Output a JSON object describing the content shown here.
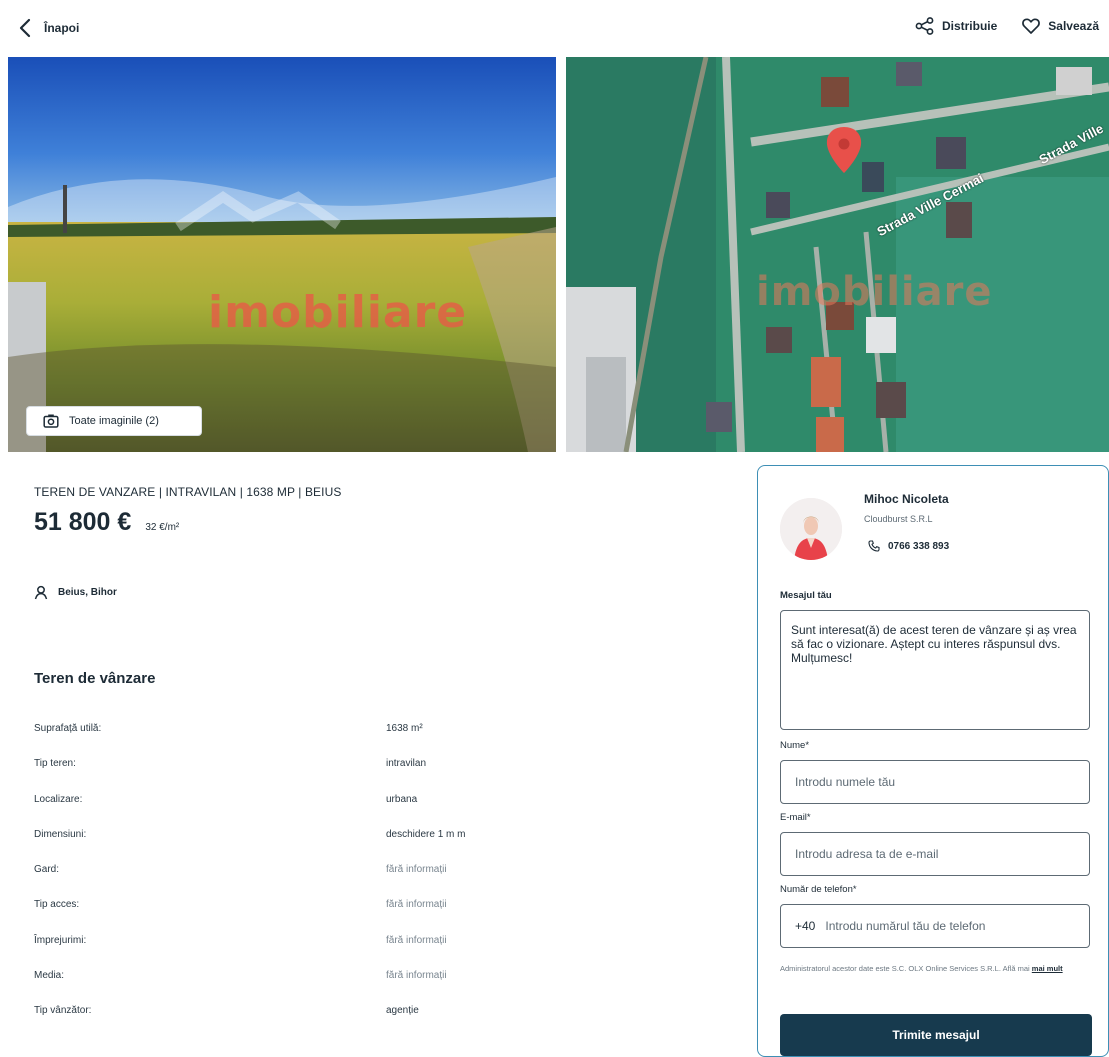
{
  "topbar": {
    "back_label": "Înapoi",
    "share_label": "Distribuie",
    "save_label": "Salvează"
  },
  "gallery": {
    "watermark": "imobiliare",
    "all_images_label": "Toate imaginile (2)",
    "streets": [
      "Strada Ville Cermai",
      "Strada Ville"
    ]
  },
  "listing": {
    "title": "TEREN DE VANZARE | INTRAVILAN | 1638 MP | BEIUS",
    "price": "51 800 €",
    "price_per_sqm": "32 €/m²",
    "location": "Beius, Bihor",
    "section_title": "Teren de vânzare"
  },
  "details": [
    {
      "label": "Suprafață utilă:",
      "value": "1638 m²"
    },
    {
      "label": "Tip teren:",
      "value": "intravilan"
    },
    {
      "label": "Localizare:",
      "value": "urbana"
    },
    {
      "label": "Dimensiuni:",
      "value": "deschidere 1 m m"
    },
    {
      "label": "Gard:",
      "value": "fără informații"
    },
    {
      "label": "Tip acces:",
      "value": "fără informații"
    },
    {
      "label": "Împrejurimi:",
      "value": "fără informații"
    },
    {
      "label": "Media:",
      "value": "fără informații"
    },
    {
      "label": "Tip vânzător:",
      "value": "agenție"
    }
  ],
  "contact": {
    "agent_name": "Mihoc Nicoleta",
    "company": "Cloudburst S.R.L",
    "phone": "0766 338 893",
    "message_label": "Mesajul tău",
    "message_value": "Sunt interesat(ă) de acest teren de vânzare și aș vrea să fac o vizionare. Aștept cu interes răspunsul dvs. Mulțumesc!",
    "name_label": "Nume*",
    "name_placeholder": "Introdu numele tău",
    "email_label": "E-mail*",
    "email_placeholder": "Introdu adresa ta de e-mail",
    "phone_label": "Număr de telefon*",
    "phone_prefix": "+40",
    "phone_placeholder": "Introdu numărul tău de telefon",
    "disclaimer": "Administratorul acestor date este S.C. OLX Online Services S.R.L. Află mai",
    "disclaimer_link": "mai mult",
    "send_label": "Trimite mesajul"
  },
  "colors": {
    "primary": "#173a4e",
    "card_border": "#3e8fb5",
    "text": "#1d2b36",
    "watermark": "#e85a46"
  }
}
